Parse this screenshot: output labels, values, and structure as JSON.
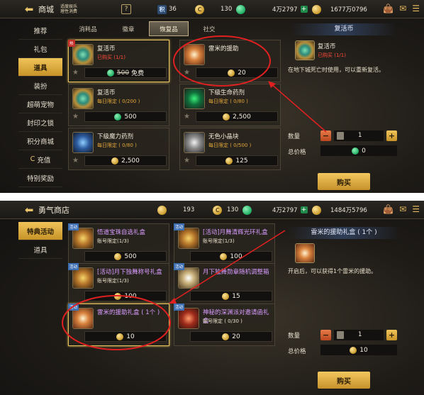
{
  "panel1": {
    "header": {
      "back_icon": "back-arrow-icon",
      "title": "商城",
      "promo": "适度娱乐 理性消费",
      "help": "?"
    },
    "currencies": [
      {
        "icon": "medal-icon",
        "value": "36"
      },
      {
        "icon": "coupon-icon",
        "value": "130"
      },
      {
        "icon": "green-gem-icon",
        "value": "4万2797"
      },
      {
        "icon": "gold-coin-icon",
        "value": "1677万0796"
      }
    ],
    "sidebar": [
      "推荐",
      "礼包",
      "道具",
      "装扮",
      "超萌宠物",
      "封印之锁",
      "积分商城",
      "充值",
      "特别奖励"
    ],
    "active_side": "道具",
    "tabs": [
      "消耗品",
      "徽章",
      "恢复品",
      "社交"
    ],
    "active_tab": "恢复品",
    "items": [
      {
        "name": "复活币",
        "limit": "已购买 (1/1)",
        "limit_red": true,
        "old_price": "500",
        "price": "免费",
        "currency": "green",
        "ribbon": "热"
      },
      {
        "name": "雷米的援助",
        "limit": "",
        "price": "20",
        "currency": "gold"
      },
      {
        "name": "复活币",
        "limit": "每日限定 ( 0/200 )",
        "price": "500",
        "currency": "green"
      },
      {
        "name": "下级生命药剂",
        "limit": "每日限定 ( 0/80 )",
        "price": "2,500",
        "currency": "gold"
      },
      {
        "name": "下级魔力药剂",
        "limit": "每日限定 ( 0/80 )",
        "price": "2,500",
        "currency": "gold"
      },
      {
        "name": "无色小晶块",
        "limit": "每日限定 ( 0/500 )",
        "price": "125",
        "currency": "gold"
      }
    ],
    "detail": {
      "title": "复活币",
      "name": "复活币",
      "limit": "已购买 (1/1)",
      "desc": "在地下城死亡时使用，可以重新复活。",
      "qty_label": "数量",
      "qty": "1",
      "total_label": "总价格",
      "total": "0",
      "buy": "购买"
    }
  },
  "panel2": {
    "header": {
      "title": "勇气商店"
    },
    "currencies": [
      {
        "icon": "gold-coin-icon",
        "value": "193"
      },
      {
        "icon": "coupon-icon",
        "value": "130"
      },
      {
        "icon": "green-gem-icon",
        "value": "4万2797"
      },
      {
        "icon": "gold-coin-icon",
        "value": "1484万5796"
      }
    ],
    "sidebar": [
      "特典活动",
      "道具"
    ],
    "active_side": "特典活动",
    "items": [
      {
        "name": "悟道宝珠自选礼盒",
        "limit": "账号限定(1/3)",
        "price": "500",
        "ribbon": "活动"
      },
      {
        "name": "[活动]月舞清辉光环礼盒",
        "limit": "账号限定(1/3)",
        "price": "100",
        "ribbon": "活动"
      },
      {
        "name": "[活动]月下独舞称号礼盒",
        "limit": "账号限定(1/3)",
        "price": "100",
        "ribbon": "活动"
      },
      {
        "name": "月下独舞勋章随机调整箱",
        "limit": "",
        "price": "15",
        "ribbon": "活动"
      },
      {
        "name": "雷米的援助礼盒 ( 1个 )",
        "limit": "",
        "price": "10",
        "ribbon": "活动"
      },
      {
        "name": "神秘的深渊派对邀请函礼盒",
        "limit": "账号限定 ( 0/30 )",
        "price": "20",
        "ribbon": "活动"
      }
    ],
    "detail": {
      "title": "雷米的援助礼盒 ( 1个 )",
      "desc": "开启后，可以获得1个雷米的援助。",
      "qty_label": "数量",
      "qty": "1",
      "total_label": "总价格",
      "total": "10",
      "buy": "购买"
    }
  }
}
